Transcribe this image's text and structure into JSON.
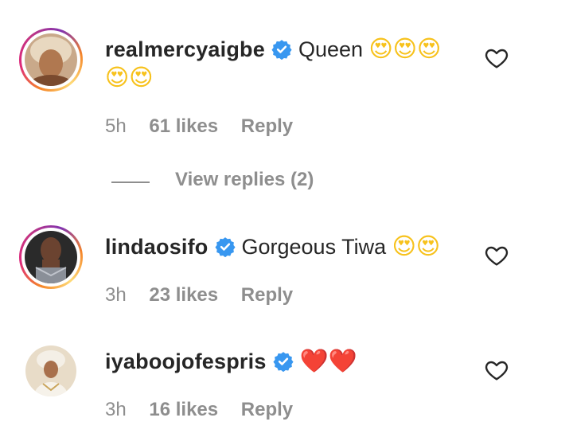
{
  "comments": [
    {
      "username": "realmercyaigbe",
      "text": "Queen",
      "emojis_line1": "😍😍😍",
      "emojis_line2": "😍😍",
      "time": "5h",
      "likes": "61 likes",
      "reply": "Reply"
    },
    {
      "username": "lindaosifo",
      "text": "Gorgeous Tiwa",
      "emojis_line1": "😍😍",
      "time": "3h",
      "likes": "23 likes",
      "reply": "Reply"
    },
    {
      "username": "iyaboojofespris",
      "text": "",
      "emojis_line1": "❤️❤️",
      "time": "3h",
      "likes": "16 likes",
      "reply": "Reply"
    }
  ],
  "view_replies": "View replies (2)",
  "colors": {
    "text": "#262626",
    "muted": "#8e8e8e",
    "verified": "#3897f0"
  }
}
